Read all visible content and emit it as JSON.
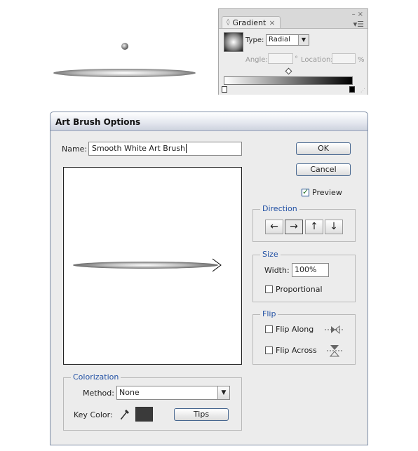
{
  "gradient_panel": {
    "tab_title": "Gradient",
    "tab_close": "×",
    "window_minimize": "–",
    "window_close": "×",
    "menu_glyph": "▾☰",
    "type_label": "Type:",
    "type_value": "Radial",
    "angle_label": "Angle:",
    "angle_value": "",
    "angle_unit": "°",
    "location_label": "Location:",
    "location_value": "",
    "location_unit": "%"
  },
  "dialog": {
    "title": "Art Brush Options",
    "name_label": "Name:",
    "name_value": "Smooth White Art Brush",
    "ok_label": "OK",
    "cancel_label": "Cancel",
    "preview_label": "Preview",
    "preview_checked": true,
    "direction": {
      "legend": "Direction",
      "buttons": [
        "←",
        "→",
        "↑",
        "↓"
      ],
      "selected_index": 1
    },
    "size": {
      "legend": "Size",
      "width_label": "Width:",
      "width_value": "100%",
      "proportional_label": "Proportional"
    },
    "flip": {
      "legend": "Flip",
      "along_label": "Flip Along",
      "across_label": "Flip Across"
    },
    "colorization": {
      "legend": "Colorization",
      "method_label": "Method:",
      "method_value": "None",
      "key_color_label": "Key Color:",
      "key_color": "#3a3a3a",
      "eyedropper_icon": "eyedropper-icon",
      "tips_label": "Tips"
    }
  }
}
